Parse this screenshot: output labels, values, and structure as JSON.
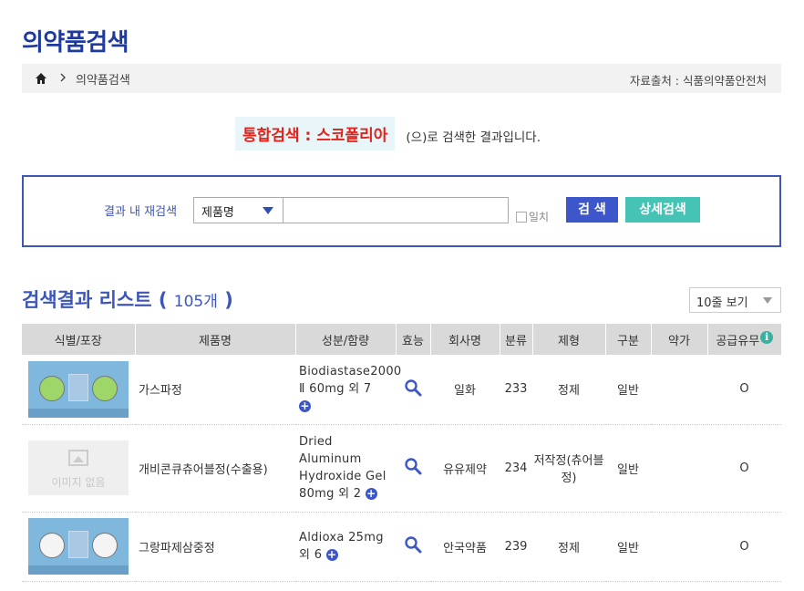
{
  "page": {
    "title": "의약품검색"
  },
  "breadcrumb": {
    "current": "의약품검색",
    "source": "자료출처 : 식품의약품안전처"
  },
  "summary": {
    "keyword": "통합검색 : 스코폴리아",
    "suffix": "(으)로 검색한 결과입니다."
  },
  "search": {
    "label": "결과 내 재검색",
    "select_value": "제품명",
    "input_value": "",
    "exact_label": "일치",
    "search_button": "검 색",
    "detail_button": "상세검색"
  },
  "list": {
    "title": "검색결과 리스트",
    "open_paren": "(",
    "count": "105개",
    "close_paren": ")",
    "rows_select": "10줄 보기"
  },
  "table": {
    "headers": [
      "식별/포장",
      "제품명",
      "성분/함량",
      "효능",
      "회사명",
      "분류",
      "제형",
      "구분",
      "약가",
      "공급유무"
    ],
    "info_icon": "i",
    "no_image_label": "이미지 없음",
    "rows": [
      {
        "image": "pill-image",
        "product": "가스파정",
        "ingredient": "Biodiastase2000 Ⅱ 60mg 외 7",
        "company": "일화",
        "class": "233",
        "form": "정제",
        "type": "일반",
        "price": "",
        "supply": "O"
      },
      {
        "image": "no-image",
        "product": "개비콘큐츄어블정(수출용)",
        "ingredient": "Dried Aluminum Hydroxide Gel 80mg 외 2",
        "company": "유유제약",
        "class": "234",
        "form": "저작정(츄어블정)",
        "type": "일반",
        "price": "",
        "supply": "O"
      },
      {
        "image": "pill-image",
        "product": "그랑파제삼중정",
        "ingredient": "Aldioxa 25mg 외 6",
        "company": "안국약품",
        "class": "239",
        "form": "정제",
        "type": "일반",
        "price": "",
        "supply": "O"
      }
    ]
  },
  "colors": {
    "title": "#1f3a9e",
    "accent_blue": "#3d56c9",
    "keyword_red": "#e0231b",
    "detail_teal": "#45c3b4",
    "pill_green": "#9ed66a",
    "pill_white": "#f4f4f4"
  },
  "icons": {
    "home": "home-icon",
    "chevron": "chevron-right-icon",
    "efficacy": "magnifier-icon",
    "more": "plus-circle-icon",
    "info": "info-icon"
  }
}
